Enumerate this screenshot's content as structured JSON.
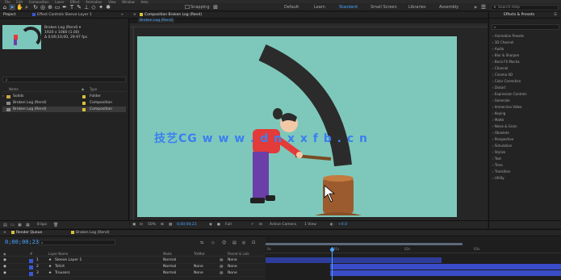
{
  "app": {
    "menu": [
      "File",
      "Edit",
      "Composition",
      "Layer",
      "Effect",
      "Animation",
      "View",
      "Window",
      "Help"
    ]
  },
  "toolbar": {
    "snapping_label": "Snapping",
    "workspaces": [
      "Default",
      "Learn",
      "Standard",
      "Small Screen",
      "Libraries",
      "Assembly"
    ],
    "active_workspace": "Standard",
    "search_placeholder": "Search Help"
  },
  "project": {
    "tabs": {
      "project": "Project",
      "effect_controls": "Effect Controls  Sleeve Layer 1"
    },
    "selected_info": {
      "name": "Broken Log (Rend)",
      "size": "1920 x 1080 (1.00)",
      "duration": "Δ 0;00;10;00, 29.97 fps"
    },
    "search_placeholder": "ρ",
    "columns": {
      "name": "Name",
      "type": "Type"
    },
    "items": [
      {
        "name": "Solids",
        "type": "Folder",
        "color": "#d8c23a"
      },
      {
        "name": "Broken Log (Rend)",
        "type": "Composition",
        "color": "#d8c23a"
      },
      {
        "name": "Broken Log (Rend)",
        "type": "Composition",
        "color": "#d8c23a"
      }
    ],
    "footer_bpc": "8 bpc"
  },
  "comp": {
    "tab_label": "Composition  Broken Log (Rend)",
    "breadcrumb": "Broken Log (Rend)",
    "zoom": "50%",
    "timecode": "0;00;00;23",
    "resolution": "Full",
    "camera": "Active Camera",
    "views": "1 View",
    "exposure": "+0.0"
  },
  "effects": {
    "tab_label": "Effects & Presets",
    "items": [
      "Animation Presets",
      "3D Channel",
      "Audio",
      "Blur & Sharpen",
      "Boris FX Mocha",
      "Channel",
      "Cinema 4D",
      "Color Correction",
      "Distort",
      "Expression Controls",
      "Generate",
      "Immersive Video",
      "Keying",
      "Matte",
      "Noise & Grain",
      "Obsolete",
      "Perspective",
      "Simulation",
      "Stylize",
      "Text",
      "Time",
      "Transition",
      "Utility"
    ]
  },
  "timeline": {
    "tabs": {
      "render_queue": "Render Queue",
      "comp": "Broken Log (Rend)"
    },
    "timecode": "0;00;00;23",
    "columns": {
      "num": "#",
      "name": "Layer Name",
      "mode": "Mode",
      "trkmat": "TrkMat",
      "parent": "Parent & Link"
    },
    "layers": [
      {
        "num": "1",
        "name": "Sleeve Layer 1",
        "mode": "Normal",
        "trkmat": "",
        "parent": "None",
        "color": "#3a57d6"
      },
      {
        "num": "2",
        "name": "Tshirt",
        "mode": "Normal",
        "trkmat": "None",
        "parent": "None",
        "color": "#3a57d6"
      },
      {
        "num": "3",
        "name": "Trousers",
        "mode": "Normal",
        "trkmat": "None",
        "parent": "None",
        "color": "#3a57d6"
      }
    ],
    "ruler": [
      "0s",
      "01s",
      "02s",
      "03s"
    ]
  },
  "watermark": "技艺CG  w w w . d n x x f b . c n",
  "colors": {
    "accent": "#4aa3ff",
    "stage": "#7ec8bb",
    "shirt": "#e33a3a",
    "pants": "#6b3fa8",
    "log": "#2b2b2b",
    "stump": "#9c5b2e"
  }
}
